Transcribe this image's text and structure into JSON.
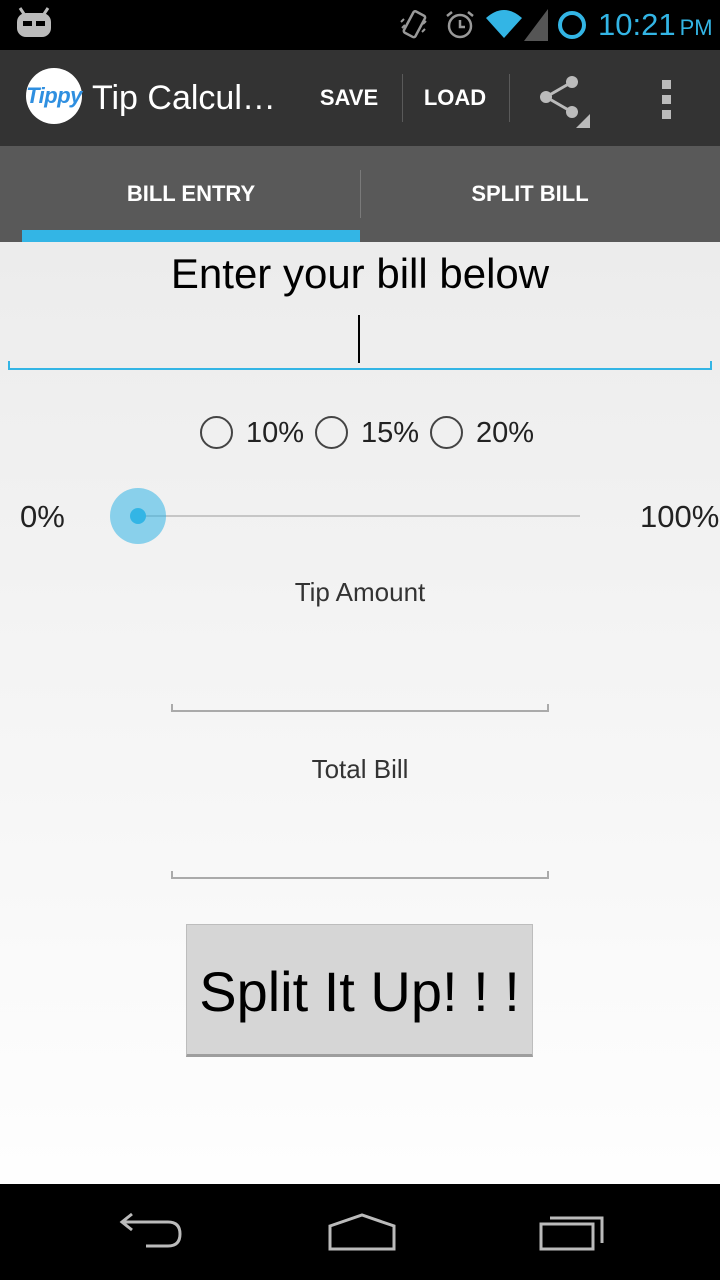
{
  "status_bar": {
    "time": "10:21",
    "ampm": "PM",
    "icons": [
      "cyanogen-robot-icon",
      "vibrate-icon",
      "alarm-icon",
      "wifi-icon",
      "signal-icon",
      "sync-ring-icon"
    ]
  },
  "action_bar": {
    "app_icon_text": "Tippy",
    "title": "Tip Calcul…",
    "save_label": "SAVE",
    "load_label": "LOAD",
    "share_icon": "share-icon",
    "overflow_icon": "overflow-menu-icon"
  },
  "tabs": [
    {
      "label": "BILL ENTRY",
      "selected": true
    },
    {
      "label": "SPLIT BILL",
      "selected": false
    }
  ],
  "bill_entry": {
    "heading": "Enter your bill below",
    "bill_value": "",
    "radio_options": [
      {
        "label": "10%",
        "checked": false
      },
      {
        "label": "15%",
        "checked": false
      },
      {
        "label": "20%",
        "checked": false
      }
    ],
    "slider": {
      "min_label": "0%",
      "max_label": "100%",
      "value_percent": 0
    },
    "tip_amount_label": "Tip Amount",
    "tip_amount_value": "",
    "total_bill_label": "Total Bill",
    "total_bill_value": "",
    "split_button_label": "Split It Up! ! !"
  },
  "colors": {
    "accent": "#33b5e5",
    "action_bar": "#333333",
    "tab_bar": "#595959"
  },
  "nav_bar": {
    "icons": [
      "back-icon",
      "home-icon",
      "recent-apps-icon"
    ]
  }
}
